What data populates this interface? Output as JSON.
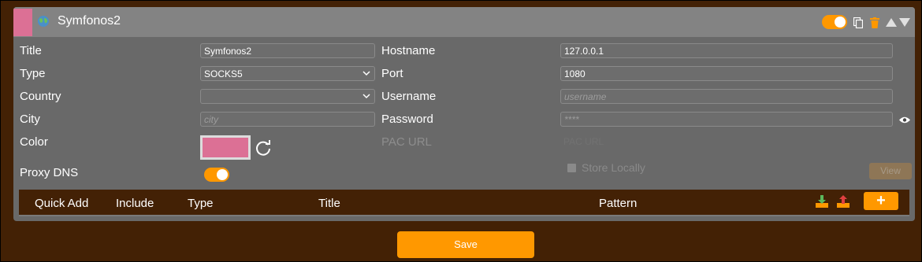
{
  "header": {
    "title": "Symfonos2",
    "accent_color": "#dc7095",
    "toggle_on": true,
    "icons": [
      "globe-icon",
      "toggle-switch",
      "duplicate-icon",
      "trash-icon",
      "move-up-icon",
      "move-down-icon"
    ]
  },
  "form": {
    "title_label": "Title",
    "title_value": "Symfonos2",
    "type_label": "Type",
    "type_value": "SOCKS5",
    "country_label": "Country",
    "country_value": "",
    "city_label": "City",
    "city_placeholder": "city",
    "color_label": "Color",
    "color_value": "#dc7095",
    "proxy_dns_label": "Proxy DNS",
    "proxy_dns_on": true,
    "hostname_label": "Hostname",
    "hostname_value": "127.0.0.1",
    "port_label": "Port",
    "port_value": "1080",
    "username_label": "Username",
    "username_placeholder": "username",
    "password_label": "Password",
    "password_placeholder": "****",
    "pac_url_label": "PAC URL",
    "pac_url_placeholder": "PAC URL",
    "store_locally_label": "Store Locally",
    "view_label": "View"
  },
  "table": {
    "headers": [
      "Quick Add",
      "Include",
      "Type",
      "Title",
      "Pattern"
    ],
    "add_label": "+"
  },
  "footer": {
    "save_label": "Save"
  },
  "colors": {
    "accent": "#ff9800",
    "background": "#432105",
    "panel": "#696969"
  }
}
